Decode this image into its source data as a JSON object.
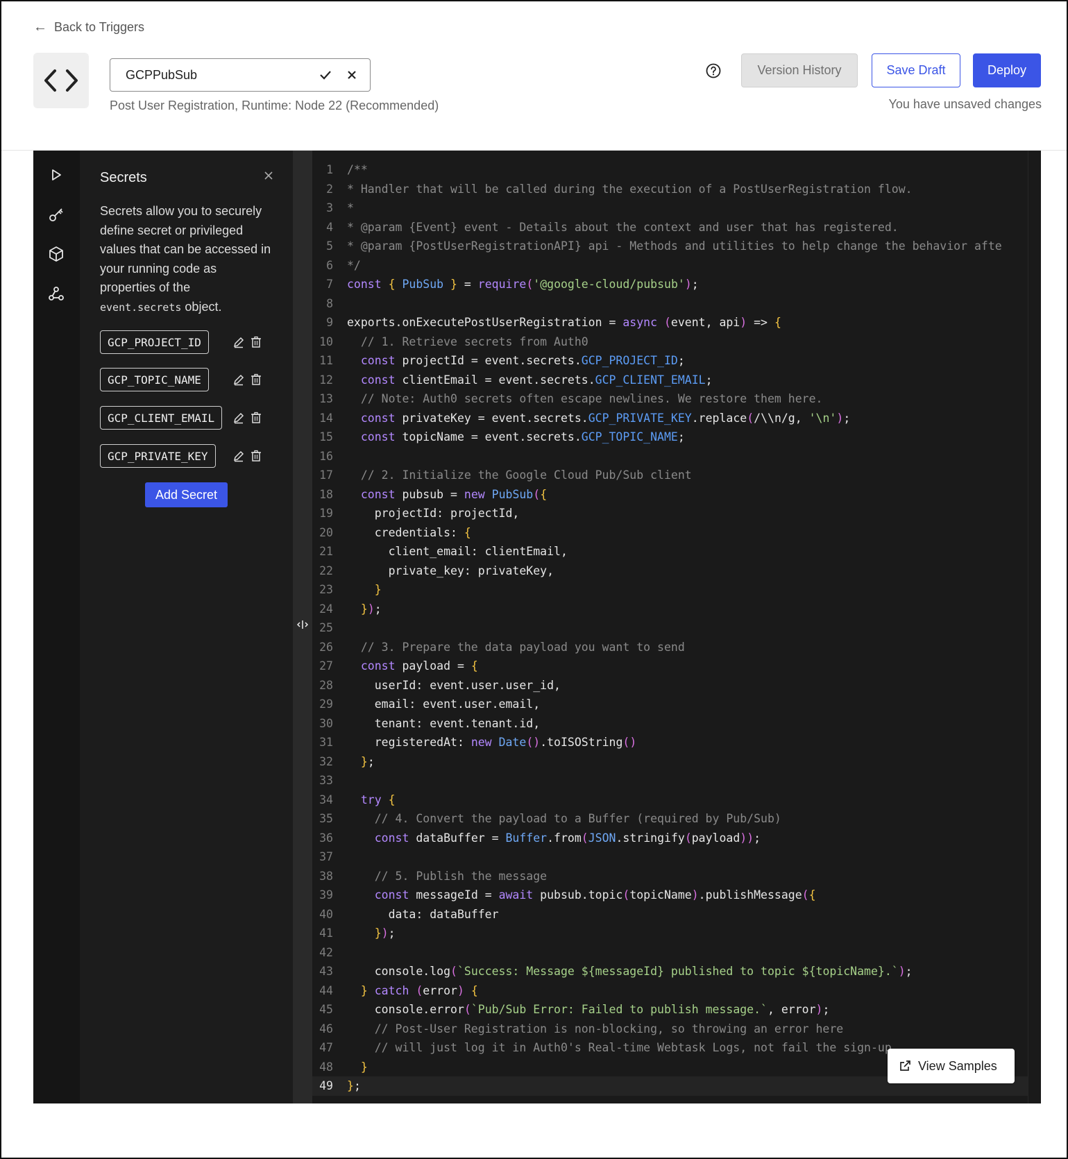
{
  "header": {
    "back_label": "Back to Triggers",
    "trigger_name": "GCPPubSub",
    "subtitle": "Post User Registration, Runtime: Node 22 (Recommended)",
    "version_history_label": "Version History",
    "save_draft_label": "Save Draft",
    "deploy_label": "Deploy",
    "unsaved_text": "You have unsaved changes"
  },
  "sidebar": {
    "rail_icons": [
      "play-icon",
      "key-icon",
      "package-icon",
      "webhook-icon"
    ],
    "title": "Secrets",
    "description_main": "Secrets allow you to securely define secret or privileged values that can be accessed in your running code as properties of the",
    "description_code": "event.secrets",
    "description_end": "object.",
    "secrets": [
      "GCP_PROJECT_ID",
      "GCP_TOPIC_NAME",
      "GCP_CLIENT_EMAIL",
      "GCP_PRIVATE_KEY"
    ],
    "add_secret_label": "Add Secret"
  },
  "editor": {
    "active_line": 49,
    "lines": [
      "/**",
      "* Handler that will be called during the execution of a PostUserRegistration flow.",
      "*",
      "* @param {Event} event - Details about the context and user that has registered.",
      "* @param {PostUserRegistrationAPI} api - Methods and utilities to help change the behavior afte",
      "*/",
      "const { PubSub } = require('@google-cloud/pubsub');",
      "",
      "exports.onExecutePostUserRegistration = async (event, api) => {",
      "  // 1. Retrieve secrets from Auth0",
      "  const projectId = event.secrets.GCP_PROJECT_ID;",
      "  const clientEmail = event.secrets.GCP_CLIENT_EMAIL;",
      "  // Note: Auth0 secrets often escape newlines. We restore them here.",
      "  const privateKey = event.secrets.GCP_PRIVATE_KEY.replace(/\\\\n/g, '\\n');",
      "  const topicName = event.secrets.GCP_TOPIC_NAME;",
      "",
      "  // 2. Initialize the Google Cloud Pub/Sub client",
      "  const pubsub = new PubSub({",
      "    projectId: projectId,",
      "    credentials: {",
      "      client_email: clientEmail,",
      "      private_key: privateKey,",
      "    }",
      "  });",
      "",
      "  // 3. Prepare the data payload you want to send",
      "  const payload = {",
      "    userId: event.user.user_id,",
      "    email: event.user.email,",
      "    tenant: event.tenant.id,",
      "    registeredAt: new Date().toISOString()",
      "  };",
      "",
      "  try {",
      "    // 4. Convert the payload to a Buffer (required by Pub/Sub)",
      "    const dataBuffer = Buffer.from(JSON.stringify(payload));",
      "",
      "    // 5. Publish the message",
      "    const messageId = await pubsub.topic(topicName).publishMessage({",
      "      data: dataBuffer",
      "    });",
      "",
      "    console.log(`Success: Message ${messageId} published to topic ${topicName}.`);",
      "  } catch (error) {",
      "    console.error(`Pub/Sub Error: Failed to publish message.`, error);",
      "    // Post-User Registration is non-blocking, so throwing an error here",
      "    // will just log it in Auth0's Real-time Webtask Logs, not fail the sign-up.",
      "  }",
      "};"
    ],
    "view_samples_label": "View Samples"
  },
  "colors": {
    "accent": "#3b55e6",
    "editor_bg": "#1a1a1a",
    "keyword": "#b388ff",
    "string": "#a6d189",
    "comment": "#8a8a8a",
    "property": "#5c9cf5"
  }
}
